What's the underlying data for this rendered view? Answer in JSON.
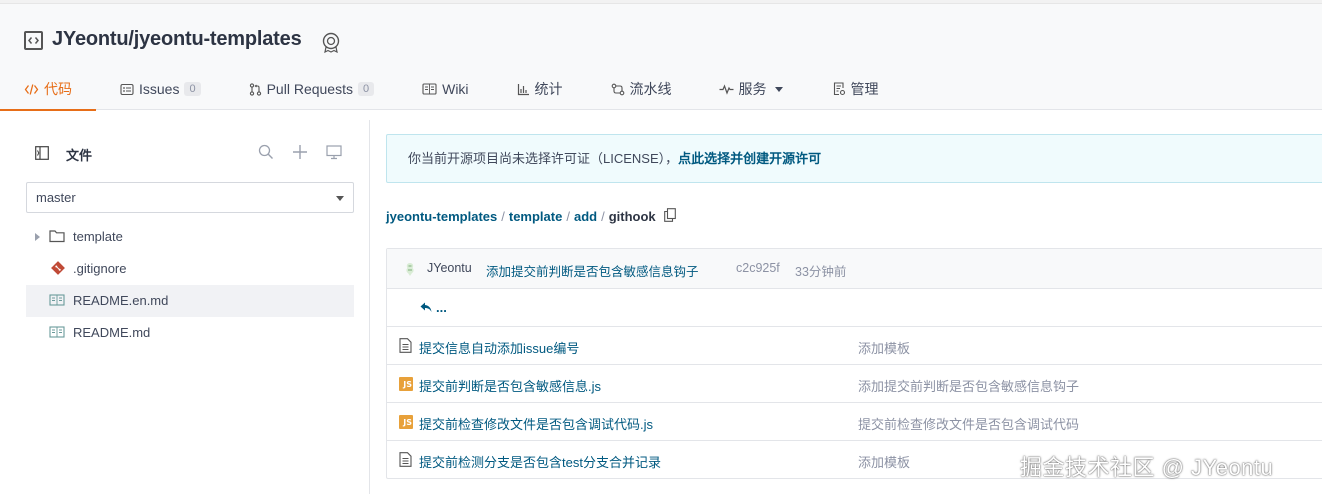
{
  "repo": {
    "title": "JYeontu/jyeontu-templates"
  },
  "tabs": [
    {
      "label": "代码",
      "icon": "code-icon",
      "active": true
    },
    {
      "label": "Issues",
      "icon": "issues-icon",
      "count": "0"
    },
    {
      "label": "Pull Requests",
      "icon": "pull-request-icon",
      "count": "0"
    },
    {
      "label": "Wiki",
      "icon": "wiki-icon"
    },
    {
      "label": "统计",
      "icon": "chart-icon"
    },
    {
      "label": "流水线",
      "icon": "pipeline-icon"
    },
    {
      "label": "服务",
      "icon": "pulse-icon",
      "dropdown": true
    },
    {
      "label": "管理",
      "icon": "settings-doc-icon"
    }
  ],
  "sidebar": {
    "title": "文件",
    "branch": "master",
    "items": [
      {
        "label": "template",
        "type": "folder"
      },
      {
        "label": ".gitignore",
        "type": "git"
      },
      {
        "label": "README.en.md",
        "type": "readme",
        "highlighted": true
      },
      {
        "label": "README.md",
        "type": "readme"
      }
    ]
  },
  "notice": {
    "text": "你当前开源项目尚未选择许可证（LICENSE），",
    "link": "点此选择并创建开源许可"
  },
  "breadcrumb": {
    "parts": [
      "jyeontu-templates",
      "template",
      "add",
      "githook"
    ],
    "separator": "/"
  },
  "commit": {
    "author": "JYeontu",
    "message": "添加提交前判断是否包含敏感信息钩子",
    "sha": "c2c925f",
    "time": "33分钟前"
  },
  "parent_link": "...",
  "files": [
    {
      "name": "提交信息自动添加issue编号",
      "type": "file",
      "message": "添加模板"
    },
    {
      "name": "提交前判断是否包含敏感信息.js",
      "type": "js",
      "message": "添加提交前判断是否包含敏感信息钩子"
    },
    {
      "name": "提交前检查修改文件是否包含调试代码.js",
      "type": "js",
      "message": "提交前检查修改文件是否包含调试代码"
    },
    {
      "name": "提交前检测分支是否包含test分支合并记录",
      "type": "file",
      "message": "添加模板"
    }
  ],
  "watermark": "掘金技术社区 @ JYeontu",
  "colors": {
    "accent": "#e76e18",
    "link": "#005980",
    "notice_bg": "#f0fbfd",
    "js": "#e8a13a",
    "git": "#c04a36"
  }
}
